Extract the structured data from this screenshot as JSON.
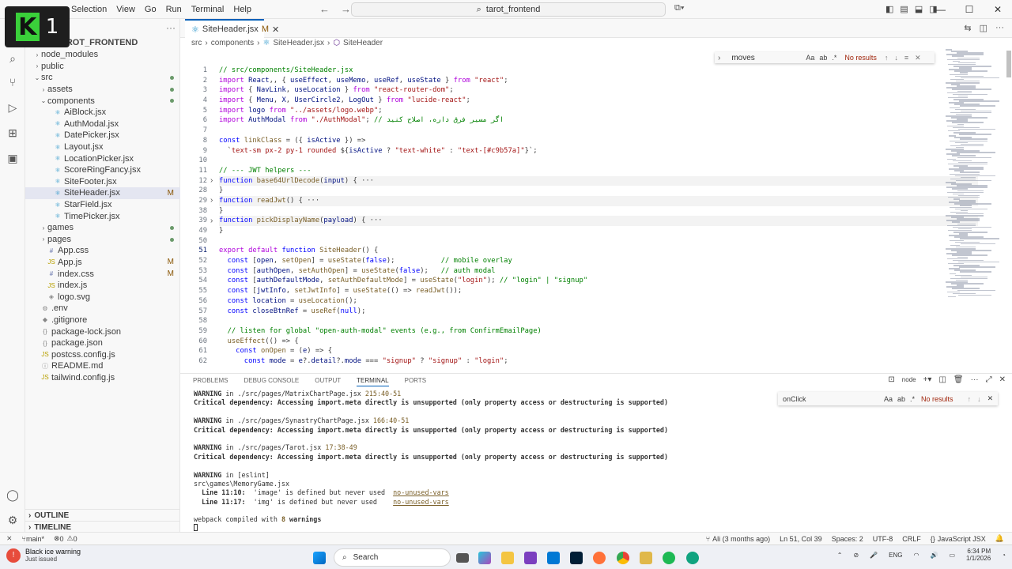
{
  "menu": [
    "Selection",
    "View",
    "Go",
    "Run",
    "Terminal",
    "Help"
  ],
  "logo": {
    "letter": "K",
    "num": "1"
  },
  "command_center": "tarot_frontend",
  "explorer": {
    "header": "TAROT_FRONTEND",
    "items": [
      {
        "label": "node_modules",
        "indent": 1,
        "chev": "›",
        "icon": "",
        "status": ""
      },
      {
        "label": "public",
        "indent": 1,
        "chev": "›",
        "icon": "",
        "status": ""
      },
      {
        "label": "src",
        "indent": 1,
        "chev": "⌄",
        "icon": "",
        "status": "dot"
      },
      {
        "label": "assets",
        "indent": 2,
        "chev": "›",
        "icon": "",
        "status": "dot"
      },
      {
        "label": "components",
        "indent": 2,
        "chev": "⌄",
        "icon": "",
        "status": "dot"
      },
      {
        "label": "AiBlock.jsx",
        "indent": 3,
        "chev": "",
        "icon": "⚛",
        "status": ""
      },
      {
        "label": "AuthModal.jsx",
        "indent": 3,
        "chev": "",
        "icon": "⚛",
        "status": ""
      },
      {
        "label": "DatePicker.jsx",
        "indent": 3,
        "chev": "",
        "icon": "⚛",
        "status": ""
      },
      {
        "label": "Layout.jsx",
        "indent": 3,
        "chev": "",
        "icon": "⚛",
        "status": ""
      },
      {
        "label": "LocationPicker.jsx",
        "indent": 3,
        "chev": "",
        "icon": "⚛",
        "status": ""
      },
      {
        "label": "ScoreRingFancy.jsx",
        "indent": 3,
        "chev": "",
        "icon": "⚛",
        "status": ""
      },
      {
        "label": "SiteFooter.jsx",
        "indent": 3,
        "chev": "",
        "icon": "⚛",
        "status": ""
      },
      {
        "label": "SiteHeader.jsx",
        "indent": 3,
        "chev": "",
        "icon": "⚛",
        "status": "M",
        "selected": true
      },
      {
        "label": "StarField.jsx",
        "indent": 3,
        "chev": "",
        "icon": "⚛",
        "status": ""
      },
      {
        "label": "TimePicker.jsx",
        "indent": 3,
        "chev": "",
        "icon": "⚛",
        "status": ""
      },
      {
        "label": "games",
        "indent": 2,
        "chev": "›",
        "icon": "",
        "status": "dot"
      },
      {
        "label": "pages",
        "indent": 2,
        "chev": "›",
        "icon": "",
        "status": "dot"
      },
      {
        "label": "App.css",
        "indent": 2,
        "chev": "",
        "icon": "#",
        "status": ""
      },
      {
        "label": "App.js",
        "indent": 2,
        "chev": "",
        "icon": "JS",
        "status": "M"
      },
      {
        "label": "index.css",
        "indent": 2,
        "chev": "",
        "icon": "#",
        "status": "M"
      },
      {
        "label": "index.js",
        "indent": 2,
        "chev": "",
        "icon": "JS",
        "status": ""
      },
      {
        "label": "logo.svg",
        "indent": 2,
        "chev": "",
        "icon": "◈",
        "status": ""
      },
      {
        "label": ".env",
        "indent": 1,
        "chev": "",
        "icon": "⚙",
        "status": ""
      },
      {
        "label": ".gitignore",
        "indent": 1,
        "chev": "",
        "icon": "◆",
        "status": ""
      },
      {
        "label": "package-lock.json",
        "indent": 1,
        "chev": "",
        "icon": "{}",
        "status": ""
      },
      {
        "label": "package.json",
        "indent": 1,
        "chev": "",
        "icon": "{}",
        "status": ""
      },
      {
        "label": "postcss.config.js",
        "indent": 1,
        "chev": "",
        "icon": "JS",
        "status": ""
      },
      {
        "label": "README.md",
        "indent": 1,
        "chev": "",
        "icon": "ⓘ",
        "status": ""
      },
      {
        "label": "tailwind.config.js",
        "indent": 1,
        "chev": "",
        "icon": "JS",
        "status": ""
      }
    ],
    "outline": "OUTLINE",
    "timeline": "TIMELINE"
  },
  "tab": {
    "label": "SiteHeader.jsx",
    "modified": "M"
  },
  "breadcrumb": [
    "src",
    "components",
    "SiteHeader.jsx",
    "SiteHeader"
  ],
  "find_widget": {
    "query": "moves",
    "case": "Aa",
    "word": "ab",
    "regex": ".*",
    "result": "No results"
  },
  "line_numbers": [
    "1",
    "2",
    "3",
    "4",
    "5",
    "6",
    "7",
    "8",
    "9",
    "10",
    "11",
    "12",
    "28",
    "29",
    "38",
    "39",
    "49",
    "50",
    "51",
    "52",
    "53",
    "54",
    "55",
    "56",
    "57",
    "58",
    "59",
    "60",
    "61",
    "62"
  ],
  "current_line": "51",
  "code_lines": [
    [
      [
        "cm",
        "// src/components/SiteHeader.jsx"
      ]
    ],
    [
      [
        "kw2",
        "import "
      ],
      [
        "var",
        "React"
      ],
      [
        "",
        ","
      ],
      [
        "",
        ", { "
      ],
      [
        "var",
        "useEffect"
      ],
      [
        "",
        ", "
      ],
      [
        "var",
        "useMemo"
      ],
      [
        "",
        ", "
      ],
      [
        "var",
        "useRef"
      ],
      [
        "",
        ", "
      ],
      [
        "var",
        "useState"
      ],
      [
        "",
        " } "
      ],
      [
        "kw2",
        "from "
      ],
      [
        "str",
        "\"react\""
      ],
      [
        "",
        ";"
      ]
    ],
    [
      [
        "kw2",
        "import "
      ],
      [
        "",
        "{ "
      ],
      [
        "var",
        "NavLink"
      ],
      [
        "",
        ", "
      ],
      [
        "var",
        "useLocation"
      ],
      [
        "",
        " } "
      ],
      [
        "kw2",
        "from "
      ],
      [
        "str",
        "\"react-router-dom\""
      ],
      [
        "",
        ";"
      ]
    ],
    [
      [
        "kw2",
        "import "
      ],
      [
        "",
        "{ "
      ],
      [
        "var",
        "Menu"
      ],
      [
        "",
        ", "
      ],
      [
        "var",
        "X"
      ],
      [
        "",
        ", "
      ],
      [
        "var",
        "UserCircle2"
      ],
      [
        "",
        ", "
      ],
      [
        "var",
        "LogOut"
      ],
      [
        "",
        " } "
      ],
      [
        "kw2",
        "from "
      ],
      [
        "str",
        "\"lucide-react\""
      ],
      [
        "",
        ";"
      ]
    ],
    [
      [
        "kw2",
        "import "
      ],
      [
        "var",
        "logo "
      ],
      [
        "kw2",
        "from "
      ],
      [
        "str",
        "\"../assets/logo.webp\""
      ],
      [
        "",
        ";"
      ]
    ],
    [
      [
        "kw2",
        "import "
      ],
      [
        "var",
        "AuthModal "
      ],
      [
        "kw2",
        "from "
      ],
      [
        "str",
        "\"./AuthModal\""
      ],
      [
        "",
        "; "
      ],
      [
        "cm",
        "// اگر مسیر فرق داره، اصلاح کنید"
      ]
    ],
    [
      [
        "",
        ""
      ]
    ],
    [
      [
        "kw",
        "const "
      ],
      [
        "fn",
        "linkClass"
      ],
      [
        "",
        " = ({ "
      ],
      [
        "var",
        "isActive"
      ],
      [
        "",
        " }) =>"
      ]
    ],
    [
      [
        "",
        "  `"
      ],
      [
        "str",
        "text-sm px-2 py-1 rounded "
      ],
      [
        "",
        "${"
      ],
      [
        "var",
        "isActive"
      ],
      [
        "",
        " ? "
      ],
      [
        "str",
        "\"text-white\""
      ],
      [
        "",
        " : "
      ],
      [
        "str",
        "\"text-[#c9b57a]\""
      ],
      [
        "",
        "}`"
      ],
      [
        "",
        ";"
      ]
    ],
    [
      [
        "",
        ""
      ]
    ],
    [
      [
        "cm",
        "// --- JWT helpers ---"
      ]
    ],
    [
      [
        "kw",
        "function "
      ],
      [
        "fn",
        "base64UrlDecode"
      ],
      [
        "",
        "("
      ],
      [
        "var",
        "input"
      ],
      [
        "",
        ") { ···"
      ]
    ],
    [
      [
        "",
        "}"
      ]
    ],
    [
      [
        "kw",
        "function "
      ],
      [
        "fn",
        "readJwt"
      ],
      [
        "",
        "() { ···"
      ]
    ],
    [
      [
        "",
        "}"
      ]
    ],
    [
      [
        "kw",
        "function "
      ],
      [
        "fn",
        "pickDisplayName"
      ],
      [
        "",
        "("
      ],
      [
        "var",
        "payload"
      ],
      [
        "",
        ") { ···"
      ]
    ],
    [
      [
        "",
        "}"
      ]
    ],
    [
      [
        "",
        ""
      ]
    ],
    [
      [
        "kw2",
        "export default "
      ],
      [
        "kw",
        "function "
      ],
      [
        "fn",
        "SiteHeader"
      ],
      [
        "",
        "() {"
      ]
    ],
    [
      [
        "kw",
        "  const "
      ],
      [
        "",
        "["
      ],
      [
        "var",
        "open"
      ],
      [
        "",
        ", "
      ],
      [
        "fn",
        "setOpen"
      ],
      [
        "",
        "] = "
      ],
      [
        "fn",
        "useState"
      ],
      [
        "",
        "("
      ],
      [
        "kw",
        "false"
      ],
      [
        "",
        ");           "
      ],
      [
        "cm",
        "// mobile overlay"
      ]
    ],
    [
      [
        "kw",
        "  const "
      ],
      [
        "",
        "["
      ],
      [
        "var",
        "authOpen"
      ],
      [
        "",
        ", "
      ],
      [
        "fn",
        "setAuthOpen"
      ],
      [
        "",
        "] = "
      ],
      [
        "fn",
        "useState"
      ],
      [
        "",
        "("
      ],
      [
        "kw",
        "false"
      ],
      [
        "",
        ");   "
      ],
      [
        "cm",
        "// auth modal"
      ]
    ],
    [
      [
        "kw",
        "  const "
      ],
      [
        "",
        "["
      ],
      [
        "var",
        "authDefaultMode"
      ],
      [
        "",
        ", "
      ],
      [
        "fn",
        "setAuthDefaultMode"
      ],
      [
        "",
        "] = "
      ],
      [
        "fn",
        "useState"
      ],
      [
        "",
        "("
      ],
      [
        "str",
        "\"login\""
      ],
      [
        "",
        "); "
      ],
      [
        "cm",
        "// \"login\" | \"signup\""
      ]
    ],
    [
      [
        "kw",
        "  const "
      ],
      [
        "",
        "["
      ],
      [
        "var",
        "jwtInfo"
      ],
      [
        "",
        ", "
      ],
      [
        "fn",
        "setJwtInfo"
      ],
      [
        "",
        "] = "
      ],
      [
        "fn",
        "useState"
      ],
      [
        "",
        "(() => "
      ],
      [
        "fn",
        "readJwt"
      ],
      [
        "",
        "());"
      ]
    ],
    [
      [
        "kw",
        "  const "
      ],
      [
        "var",
        "location"
      ],
      [
        "",
        " = "
      ],
      [
        "fn",
        "useLocation"
      ],
      [
        "",
        "();"
      ]
    ],
    [
      [
        "kw",
        "  const "
      ],
      [
        "var",
        "closeBtnRef"
      ],
      [
        "",
        " = "
      ],
      [
        "fn",
        "useRef"
      ],
      [
        "",
        "("
      ],
      [
        "kw",
        "null"
      ],
      [
        "",
        ");"
      ]
    ],
    [
      [
        "",
        ""
      ]
    ],
    [
      [
        "cm",
        "  // listen for global \"open-auth-modal\" events (e.g., from ConfirmEmailPage)"
      ]
    ],
    [
      [
        "",
        "  "
      ],
      [
        "fn",
        "useEffect"
      ],
      [
        "",
        "(() => {"
      ]
    ],
    [
      [
        "kw",
        "    const "
      ],
      [
        "fn",
        "onOpen"
      ],
      [
        "",
        " = ("
      ],
      [
        "var",
        "e"
      ],
      [
        "",
        ") => {"
      ]
    ],
    [
      [
        "kw",
        "      const "
      ],
      [
        "var",
        "mode"
      ],
      [
        "",
        " = "
      ],
      [
        "var",
        "e"
      ],
      [
        "",
        "?."
      ],
      [
        "var",
        "detail"
      ],
      [
        "",
        "?."
      ],
      [
        "var",
        "mode"
      ],
      [
        "",
        " === "
      ],
      [
        "str",
        "\"signup\""
      ],
      [
        "",
        " ? "
      ],
      [
        "str",
        "\"signup\""
      ],
      [
        "",
        " : "
      ],
      [
        "str",
        "\"login\""
      ],
      [
        "",
        ";"
      ]
    ]
  ],
  "panel": {
    "tabs": [
      "PROBLEMS",
      "DEBUG CONSOLE",
      "OUTPUT",
      "TERMINAL",
      "PORTS"
    ],
    "shell": "node"
  },
  "terminal_lines": [
    [
      [
        "warn",
        "WARNING"
      ],
      [
        "path",
        " in ./src/pages/MatrixChartPage.jsx "
      ],
      [
        "pos",
        "215:40-51"
      ]
    ],
    [
      [
        "warn",
        "Critical dependency: Accessing import.meta directly is unsupported (only property access or destructuring is supported)"
      ]
    ],
    [
      [
        "",
        ""
      ]
    ],
    [
      [
        "warn",
        "WARNING"
      ],
      [
        "path",
        " in ./src/pages/SynastryChartPage.jsx "
      ],
      [
        "pos",
        "166:40-51"
      ]
    ],
    [
      [
        "warn",
        "Critical dependency: Accessing import.meta directly is unsupported (only property access or destructuring is supported)"
      ]
    ],
    [
      [
        "",
        ""
      ]
    ],
    [
      [
        "warn",
        "WARNING"
      ],
      [
        "path",
        " in ./src/pages/Tarot.jsx "
      ],
      [
        "pos",
        "17:38-49"
      ]
    ],
    [
      [
        "warn",
        "Critical dependency: Accessing import.meta directly is unsupported (only property access or destructuring is supported)"
      ]
    ],
    [
      [
        "",
        ""
      ]
    ],
    [
      [
        "warn",
        "WARNING"
      ],
      [
        "path",
        " in [eslint]"
      ]
    ],
    [
      [
        "path",
        "src\\games\\MemoryGame.jsx"
      ]
    ],
    [
      [
        "warn",
        "  Line 11:10:"
      ],
      [
        "path",
        "  'image' is defined but never used  "
      ],
      [
        "rule",
        "no-unused-vars"
      ]
    ],
    [
      [
        "warn",
        "  Line 11:17:"
      ],
      [
        "path",
        "  'img' is defined but never used    "
      ],
      [
        "rule",
        "no-unused-vars"
      ]
    ],
    [
      [
        "",
        ""
      ]
    ],
    [
      [
        "path",
        "webpack compiled with "
      ],
      [
        "num",
        "8"
      ],
      [
        "warn",
        " warnings"
      ]
    ]
  ],
  "terminal_find": {
    "query": "onClick",
    "result": "No results"
  },
  "status": {
    "branch": "main*",
    "errors": "0",
    "warnings": "0",
    "blame": "Ali (3 months ago)",
    "position": "Ln 51, Col 39",
    "spaces": "Spaces: 2",
    "encoding": "UTF-8",
    "eol": "CRLF",
    "language": "JavaScript JSX"
  },
  "taskbar": {
    "weather_title": "Black ice warning",
    "weather_sub": "Just issued",
    "search": "Search",
    "lang": "ENG",
    "time": "6:34 PM",
    "date": "1/1/2026"
  }
}
